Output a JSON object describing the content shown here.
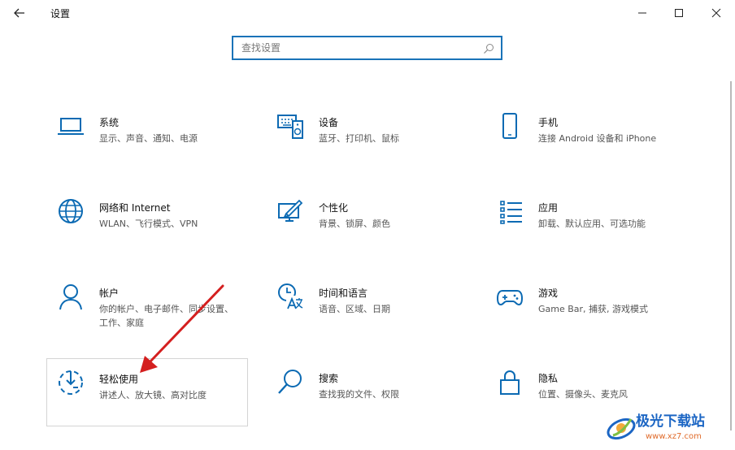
{
  "window": {
    "title": "设置",
    "controls": {
      "minimize": "minimize-icon",
      "maximize": "maximize-icon",
      "close": "close-icon"
    }
  },
  "search": {
    "placeholder": "查找设置"
  },
  "tiles": [
    {
      "name": "系统",
      "desc": "显示、声音、通知、电源",
      "icon": "laptop-icon"
    },
    {
      "name": "设备",
      "desc": "蓝牙、打印机、鼠标",
      "icon": "keyboard-speaker-icon"
    },
    {
      "name": "手机",
      "desc": "连接 Android 设备和 iPhone",
      "icon": "phone-icon"
    },
    {
      "name": "网络和 Internet",
      "desc": "WLAN、飞行模式、VPN",
      "icon": "globe-icon"
    },
    {
      "name": "个性化",
      "desc": "背景、锁屏、颜色",
      "icon": "paint-brush-icon"
    },
    {
      "name": "应用",
      "desc": "卸载、默认应用、可选功能",
      "icon": "apps-list-icon"
    },
    {
      "name": "帐户",
      "desc": "你的帐户、电子邮件、同步设置、工作、家庭",
      "icon": "person-icon"
    },
    {
      "name": "时间和语言",
      "desc": "语音、区域、日期",
      "icon": "time-language-icon"
    },
    {
      "name": "游戏",
      "desc": "Game Bar, 捕获, 游戏模式",
      "icon": "gamepad-icon"
    },
    {
      "name": "轻松使用",
      "desc": "讲述人、放大镜、高对比度",
      "icon": "ease-of-access-icon"
    },
    {
      "name": "搜索",
      "desc": "查找我的文件、权限",
      "icon": "magnifier-icon"
    },
    {
      "name": "隐私",
      "desc": "位置、摄像头、麦克风",
      "icon": "lock-icon"
    }
  ],
  "watermark": {
    "text": "极光下载站",
    "url": "www.xz7.com"
  },
  "colors": {
    "accent": "#0b6ab3",
    "annotation_arrow": "#d41f1f",
    "watermark_blue": "#1c66c4",
    "watermark_orange": "#e06b2b"
  }
}
